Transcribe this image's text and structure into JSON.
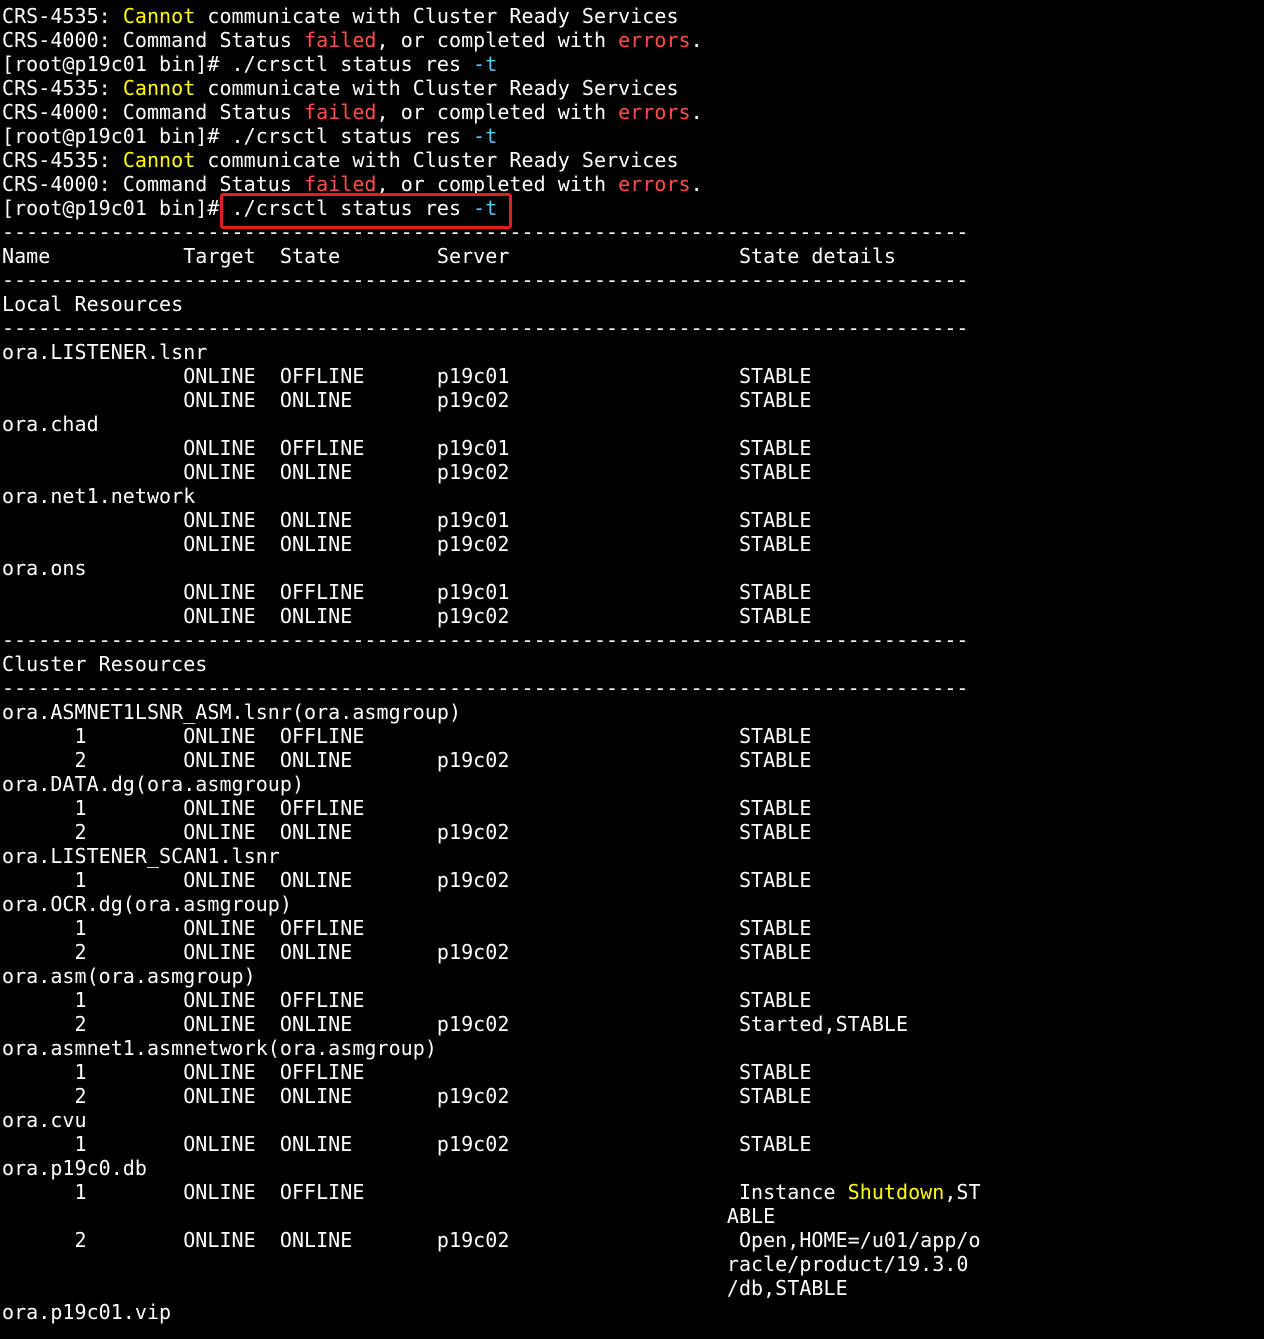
{
  "terminal": {
    "colors": {
      "background": "#000000",
      "text": "#ffffff",
      "warning": "#ffff00",
      "error": "#ff4c4c",
      "option": "#55c8ff",
      "highlight_box": "#e02020"
    },
    "lines": [
      [
        {
          "t": "CRS-4535: "
        },
        {
          "t": "Cannot",
          "c": "y"
        },
        {
          "t": " communicate with Cluster Ready Services"
        }
      ],
      [
        {
          "t": "CRS-4000: Command Status "
        },
        {
          "t": "failed",
          "c": "r"
        },
        {
          "t": ", or completed with "
        },
        {
          "t": "errors",
          "c": "r"
        },
        {
          "t": "."
        }
      ],
      [
        {
          "t": "[root@p19c01 bin]# ./crsctl status res "
        },
        {
          "t": "-t",
          "c": "c"
        }
      ],
      [
        {
          "t": "CRS-4535: "
        },
        {
          "t": "Cannot",
          "c": "y"
        },
        {
          "t": " communicate with Cluster Ready Services"
        }
      ],
      [
        {
          "t": "CRS-4000: Command Status "
        },
        {
          "t": "failed",
          "c": "r"
        },
        {
          "t": ", or completed with "
        },
        {
          "t": "errors",
          "c": "r"
        },
        {
          "t": "."
        }
      ],
      [
        {
          "t": "[root@p19c01 bin]# ./crsctl status res "
        },
        {
          "t": "-t",
          "c": "c"
        }
      ],
      [
        {
          "t": "CRS-4535: "
        },
        {
          "t": "Cannot",
          "c": "y"
        },
        {
          "t": " communicate with Cluster Ready Services"
        }
      ],
      [
        {
          "t": "CRS-4000: Command Status "
        },
        {
          "t": "failed",
          "c": "r"
        },
        {
          "t": ", or completed with "
        },
        {
          "t": "errors",
          "c": "r"
        },
        {
          "t": "."
        }
      ],
      [
        {
          "t": "[root@p19c01 bin]# ./crsctl status res "
        },
        {
          "t": "-t",
          "c": "c"
        }
      ],
      [
        {
          "t": "--------------------------------------------------------------------------------"
        }
      ],
      [
        {
          "t": "Name           Target  State        Server                   State details"
        }
      ],
      [
        {
          "t": "--------------------------------------------------------------------------------"
        }
      ],
      [
        {
          "t": "Local Resources"
        }
      ],
      [
        {
          "t": "--------------------------------------------------------------------------------"
        }
      ],
      [
        {
          "t": "ora.LISTENER.lsnr"
        }
      ],
      [
        {
          "t": "               ONLINE  OFFLINE      p19c01                   STABLE"
        }
      ],
      [
        {
          "t": "               ONLINE  ONLINE       p19c02                   STABLE"
        }
      ],
      [
        {
          "t": "ora.chad"
        }
      ],
      [
        {
          "t": "               ONLINE  OFFLINE      p19c01                   STABLE"
        }
      ],
      [
        {
          "t": "               ONLINE  ONLINE       p19c02                   STABLE"
        }
      ],
      [
        {
          "t": "ora.net1.network"
        }
      ],
      [
        {
          "t": "               ONLINE  ONLINE       p19c01                   STABLE"
        }
      ],
      [
        {
          "t": "               ONLINE  ONLINE       p19c02                   STABLE"
        }
      ],
      [
        {
          "t": "ora.ons"
        }
      ],
      [
        {
          "t": "               ONLINE  OFFLINE      p19c01                   STABLE"
        }
      ],
      [
        {
          "t": "               ONLINE  ONLINE       p19c02                   STABLE"
        }
      ],
      [
        {
          "t": "--------------------------------------------------------------------------------"
        }
      ],
      [
        {
          "t": "Cluster Resources"
        }
      ],
      [
        {
          "t": "--------------------------------------------------------------------------------"
        }
      ],
      [
        {
          "t": "ora.ASMNET1LSNR_ASM.lsnr(ora.asmgroup)"
        }
      ],
      [
        {
          "t": "      1        ONLINE  OFFLINE                               STABLE"
        }
      ],
      [
        {
          "t": "      2        ONLINE  ONLINE       p19c02                   STABLE"
        }
      ],
      [
        {
          "t": "ora.DATA.dg(ora.asmgroup)"
        }
      ],
      [
        {
          "t": "      1        ONLINE  OFFLINE                               STABLE"
        }
      ],
      [
        {
          "t": "      2        ONLINE  ONLINE       p19c02                   STABLE"
        }
      ],
      [
        {
          "t": "ora.LISTENER_SCAN1.lsnr"
        }
      ],
      [
        {
          "t": "      1        ONLINE  ONLINE       p19c02                   STABLE"
        }
      ],
      [
        {
          "t": "ora.OCR.dg(ora.asmgroup)"
        }
      ],
      [
        {
          "t": "      1        ONLINE  OFFLINE                               STABLE"
        }
      ],
      [
        {
          "t": "      2        ONLINE  ONLINE       p19c02                   STABLE"
        }
      ],
      [
        {
          "t": "ora.asm(ora.asmgroup)"
        }
      ],
      [
        {
          "t": "      1        ONLINE  OFFLINE                               STABLE"
        }
      ],
      [
        {
          "t": "      2        ONLINE  ONLINE       p19c02                   Started,STABLE"
        }
      ],
      [
        {
          "t": "ora.asmnet1.asmnetwork(ora.asmgroup)"
        }
      ],
      [
        {
          "t": "      1        ONLINE  OFFLINE                               STABLE"
        }
      ],
      [
        {
          "t": "      2        ONLINE  ONLINE       p19c02                   STABLE"
        }
      ],
      [
        {
          "t": "ora.cvu"
        }
      ],
      [
        {
          "t": "      1        ONLINE  ONLINE       p19c02                   STABLE"
        }
      ],
      [
        {
          "t": "ora.p19c0.db"
        }
      ],
      [
        {
          "t": "      1        ONLINE  OFFLINE                               Instance "
        },
        {
          "t": "Shutdown",
          "c": "y"
        },
        {
          "t": ",ST"
        }
      ],
      [
        {
          "t": "                                                            ABLE"
        }
      ],
      [
        {
          "t": "      2        ONLINE  ONLINE       p19c02                   Open,HOME=/u01/app/o"
        }
      ],
      [
        {
          "t": "                                                            racle/product/19.3.0"
        }
      ],
      [
        {
          "t": "                                                            /db,STABLE"
        }
      ],
      [
        {
          "t": "ora.p19c01.vip"
        }
      ]
    ]
  }
}
